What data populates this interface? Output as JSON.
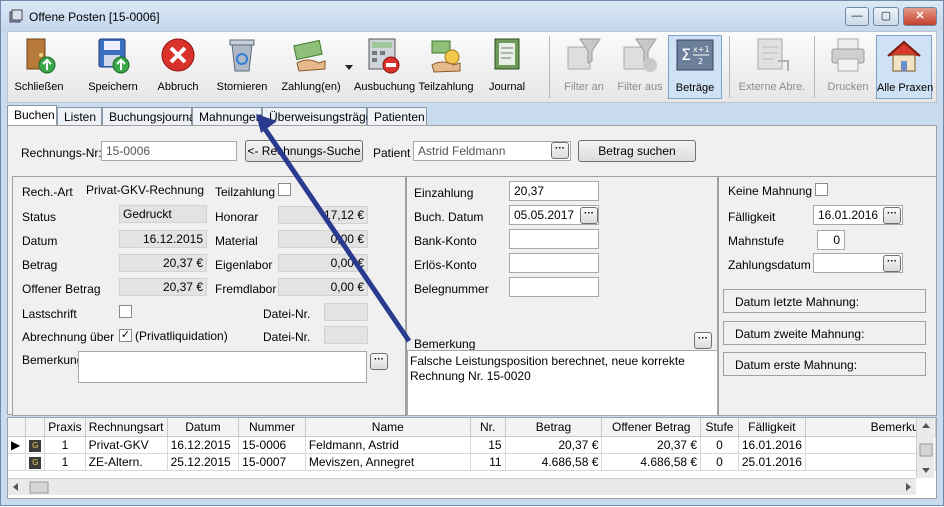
{
  "window": {
    "title": "Offene Posten  [15-0006]",
    "controls": {
      "minimize": "—",
      "maximize": "▢",
      "close": "✕"
    }
  },
  "toolbar": {
    "buttons": [
      {
        "label": "Schließen",
        "icon": "door-exit-icon",
        "enabled": true
      },
      {
        "label": "Speichern",
        "icon": "floppy-save-icon",
        "enabled": true
      },
      {
        "label": "Abbruch",
        "icon": "cancel-x-icon",
        "enabled": true
      },
      {
        "label": "Stornieren",
        "icon": "recycle-bin-icon",
        "enabled": true
      },
      {
        "label": "Zahlung(en)",
        "icon": "money-hand-icon",
        "enabled": true
      },
      {
        "label": "Ausbuchung",
        "icon": "calculator-remove-icon",
        "enabled": true
      },
      {
        "label": "Teilzahlung",
        "icon": "partial-payment-icon",
        "enabled": true
      },
      {
        "label": "Journal",
        "icon": "journal-book-icon",
        "enabled": true
      },
      {
        "label": "Filter an",
        "icon": "filter-on-icon",
        "enabled": false
      },
      {
        "label": "Filter aus",
        "icon": "filter-off-icon",
        "enabled": false
      },
      {
        "label": "Beträge",
        "icon": "sum-formula-icon",
        "enabled": true,
        "active": true
      },
      {
        "label": "Externe Abre.",
        "icon": "external-billing-icon",
        "enabled": false
      },
      {
        "label": "Drucken",
        "icon": "printer-icon",
        "enabled": false
      },
      {
        "label": "Alle Praxen",
        "icon": "house-icon",
        "enabled": true,
        "active": true
      }
    ]
  },
  "tabs": [
    "Buchen",
    "Listen",
    "Buchungsjournal",
    "Mahnungen",
    "Überweisungsträger",
    "Patienten"
  ],
  "search": {
    "rechnungsnr_label": "Rechnungs-Nr:",
    "rechnungsnr_value": "15-0006",
    "suche_button": "<- Rechnungs-Suche",
    "patient_label": "Patient",
    "patient_value": "Astrid Feldmann",
    "betrag_button": "Betrag suchen"
  },
  "details": {
    "rechart_label": "Rech.-Art",
    "rechart_value": "Privat-GKV-Rechnung",
    "status_label": "Status",
    "status_value": "Gedruckt",
    "datum_label": "Datum",
    "datum_value": "16.12.2015",
    "betrag_label": "Betrag",
    "betrag_value": "20,37 €",
    "offen_label": "Offener Betrag",
    "offen_value": "20,37 €",
    "lastschrift_label": "Lastschrift",
    "abrechnung_label": "Abrechnung über",
    "abrechnung_value": "(Privatliquidation)",
    "bemerkung_label": "Bemerkung",
    "teilzahlung_label": "Teilzahlung",
    "honorar_label": "Honorar",
    "honorar_value": "17,12 €",
    "material_label": "Material",
    "material_value": "0,00 €",
    "eigenlabor_label": "Eigenlabor",
    "eigenlabor_value": "0,00 €",
    "fremdlabor_label": "Fremdlabor",
    "fremdlabor_value": "0,00 €",
    "dateinr_label": "Datei-Nr."
  },
  "payment": {
    "einzahlung_label": "Einzahlung",
    "einzahlung_value": "20,37",
    "buchdatum_label": "Buch. Datum",
    "buchdatum_value": "05.05.2017",
    "bankkonto_label": "Bank-Konto",
    "erloes_label": "Erlös-Konto",
    "beleg_label": "Belegnummer",
    "bemerkung_label": "Bemerkung",
    "bemerkung_text": "Falsche Leistungsposition berechnet, neue korrekte Rechnung Nr. 15-0020"
  },
  "dunning": {
    "keine_label": "Keine Mahnung",
    "faelligkeit_label": "Fälligkeit",
    "faelligkeit_value": "16.01.2016",
    "mahnstufe_label": "Mahnstufe",
    "mahnstufe_value": "0",
    "zahlungsdatum_label": "Zahlungsdatum",
    "letzte": "Datum letzte Mahnung:",
    "zweite": "Datum zweite Mahnung:",
    "erste": "Datum erste Mahnung:"
  },
  "grid": {
    "columns": [
      "Praxis",
      "Rechnungsart",
      "Datum",
      "Nummer",
      "Name",
      "Nr.",
      "Betrag",
      "Offener Betrag",
      "Stufe",
      "Fälligkeit",
      "Bemerkung"
    ],
    "rows": [
      {
        "praxis": "1",
        "art": "Privat-GKV",
        "datum": "16.12.2015",
        "nummer": "15-0006",
        "name": "Feldmann, Astrid",
        "nr": "15",
        "betrag": "20,37 €",
        "offen": "20,37 €",
        "stufe": "0",
        "faellig": "16.01.2016",
        "bemerkung": ""
      },
      {
        "praxis": "1",
        "art": "ZE-Altern.",
        "datum": "25.12.2015",
        "nummer": "15-0007",
        "name": "Meviszen, Annegret",
        "nr": "11",
        "betrag": "4.686,58 €",
        "offen": "4.686,58 €",
        "stufe": "0",
        "faellig": "25.01.2016",
        "bemerkung": ""
      }
    ]
  },
  "colors": {
    "annotation_arrow": "#2a3a8f",
    "titlebar": "#c9dbef",
    "close_button": "#c4412c"
  }
}
